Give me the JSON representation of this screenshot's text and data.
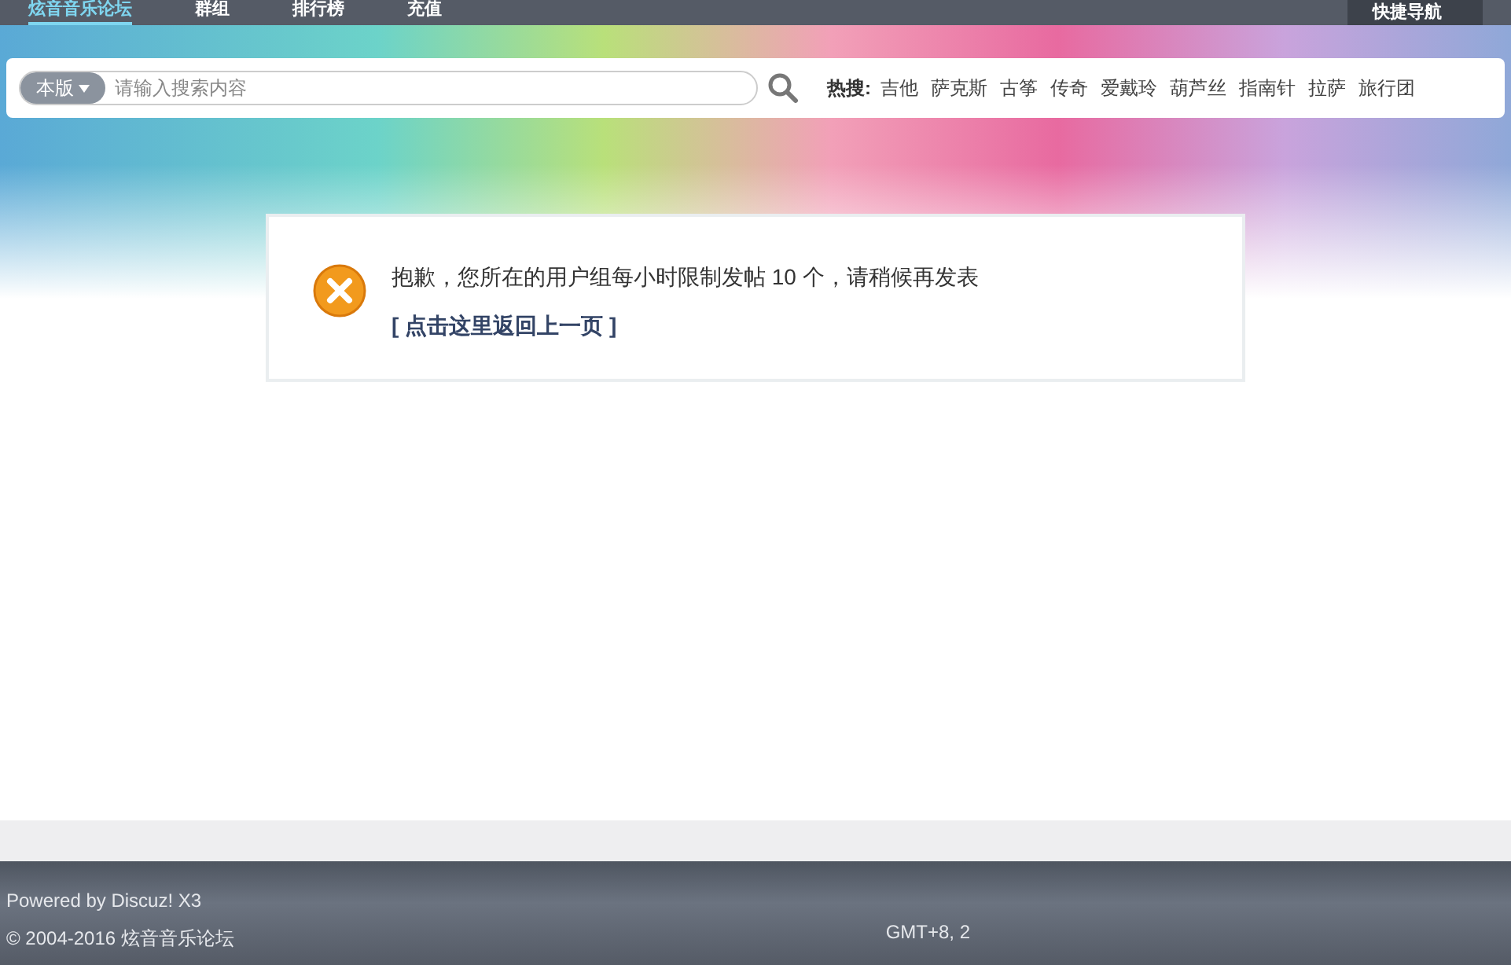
{
  "nav": {
    "items": [
      {
        "label": "炫音音乐论坛",
        "selected": true
      },
      {
        "label": "群组",
        "selected": false
      },
      {
        "label": "排行榜",
        "selected": false
      },
      {
        "label": "充值",
        "selected": false
      }
    ],
    "quick_nav": "快捷导航"
  },
  "search": {
    "scope": "本版",
    "placeholder": "请输入搜索内容",
    "hot_label": "热搜:",
    "hot_terms": [
      "吉他",
      "萨克斯",
      "古筝",
      "传奇",
      "爱戴玲",
      "葫芦丝",
      "指南针",
      "拉萨",
      "旅行团"
    ]
  },
  "message": {
    "text": "抱歉，您所在的用户组每小时限制发帖 10 个，请稍候再发表",
    "link": "[ 点击这里返回上一页 ]"
  },
  "footer": {
    "powered": "Powered by Discuz! X3",
    "copyright": "© 2004-2016 炫音音乐论坛",
    "time": "GMT+8, 2"
  }
}
